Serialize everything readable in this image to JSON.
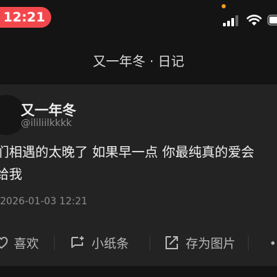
{
  "status_bar": {
    "time": "12:21",
    "time_pill_color": "#f2484d"
  },
  "nav": {
    "title": "又一年冬 · 日记"
  },
  "post": {
    "author_name": "又一年冬",
    "author_handle": "@ililiilkkkk",
    "body": "们相遇的太晚了 如果早一点 你最纯真的爱会\n给我",
    "timestamp": "2026-01-03 12:21"
  },
  "actions": {
    "like_label": "喜欢",
    "note_label": "小纸条",
    "save_label": "存为图片"
  }
}
